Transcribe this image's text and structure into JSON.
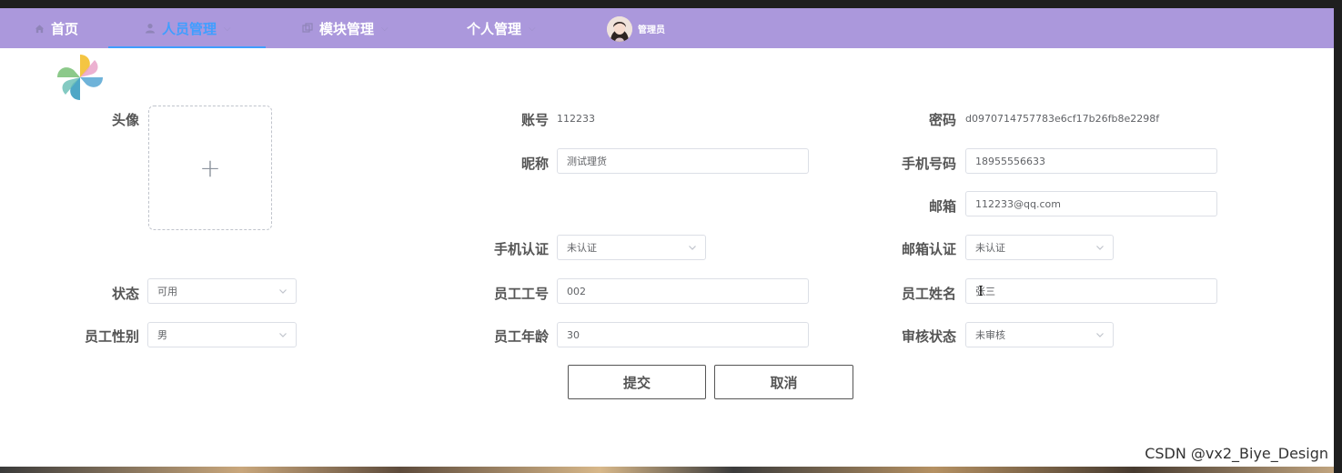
{
  "nav": {
    "items": [
      {
        "label": "首页",
        "icon": "home-icon"
      },
      {
        "label": "人员管理",
        "icon": "user-icon",
        "active": true
      },
      {
        "label": "模块管理",
        "icon": "module-icon"
      },
      {
        "label": "个人管理",
        "icon": ""
      }
    ],
    "admin_name": "管理员",
    "accent": "#ab98dc",
    "active_color": "#409eff"
  },
  "form": {
    "avatar_label": "头像",
    "upload_plus": "+",
    "account_label": "账号",
    "account_value": "112233",
    "password_label": "密码",
    "password_value": "d0970714757783e6cf17b26fb8e2298f",
    "nickname_label": "昵称",
    "nickname_value": "测试理货",
    "phone_label": "手机号码",
    "phone_value": "18955556633",
    "email_label": "邮箱",
    "email_value": "112233@qq.com",
    "phone_verify_label": "手机认证",
    "phone_verify_value": "未认证",
    "email_verify_label": "邮箱认证",
    "email_verify_value": "未认证",
    "status_label": "状态",
    "status_value": "可用",
    "emp_no_label": "员工工号",
    "emp_no_value": "002",
    "emp_name_label": "员工姓名",
    "emp_name_value": "张三",
    "gender_label": "员工性别",
    "gender_value": "男",
    "age_label": "员工年龄",
    "age_value": "30",
    "audit_label": "审核状态",
    "audit_value": "未审核"
  },
  "buttons": {
    "submit": "提交",
    "cancel": "取消"
  },
  "watermark": "CSDN @vx2_Biye_Design"
}
